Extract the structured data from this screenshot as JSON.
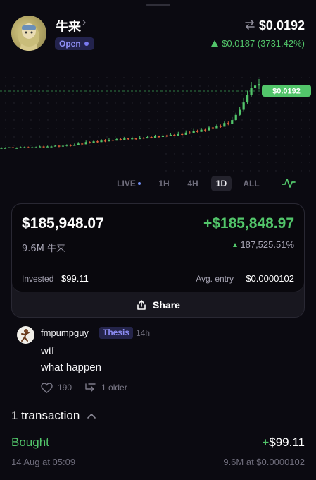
{
  "header": {
    "token_name": "牛来",
    "status": "Open",
    "price": "$0.0192",
    "change": "$0.0187 (3731.42%)",
    "icons": {
      "name": "chevron-right-icon",
      "swap": "swap-icon",
      "change": "triangle-up-icon"
    }
  },
  "chart": {
    "current_price_label": "$0.0192",
    "colors": {
      "up": "#52c56a",
      "down": "#e0603a",
      "dashed_line": "#2d6b3a",
      "grid_dot": "#2a2933"
    }
  },
  "chart_data": {
    "type": "candlestick",
    "x_unit": "candle index",
    "y_unit": "relative price",
    "candles": [
      [
        0.1,
        0.1,
        0.11,
        0.1
      ],
      [
        0.1,
        0.1,
        0.11,
        0.1
      ],
      [
        0.1,
        0.11,
        0.11,
        0.1
      ],
      [
        0.11,
        0.1,
        0.11,
        0.1
      ],
      [
        0.1,
        0.1,
        0.11,
        0.1
      ],
      [
        0.1,
        0.11,
        0.12,
        0.1
      ],
      [
        0.11,
        0.11,
        0.12,
        0.1
      ],
      [
        0.11,
        0.1,
        0.12,
        0.1
      ],
      [
        0.1,
        0.11,
        0.12,
        0.1
      ],
      [
        0.11,
        0.11,
        0.12,
        0.1
      ],
      [
        0.11,
        0.12,
        0.13,
        0.11
      ],
      [
        0.12,
        0.11,
        0.13,
        0.1
      ],
      [
        0.11,
        0.12,
        0.13,
        0.11
      ],
      [
        0.12,
        0.12,
        0.13,
        0.11
      ],
      [
        0.12,
        0.13,
        0.14,
        0.12
      ],
      [
        0.13,
        0.12,
        0.14,
        0.11
      ],
      [
        0.12,
        0.13,
        0.14,
        0.12
      ],
      [
        0.13,
        0.14,
        0.15,
        0.12
      ],
      [
        0.14,
        0.13,
        0.15,
        0.12
      ],
      [
        0.13,
        0.14,
        0.16,
        0.13
      ],
      [
        0.14,
        0.16,
        0.18,
        0.14
      ],
      [
        0.16,
        0.15,
        0.17,
        0.14
      ],
      [
        0.15,
        0.18,
        0.2,
        0.15
      ],
      [
        0.18,
        0.17,
        0.19,
        0.16
      ],
      [
        0.17,
        0.19,
        0.21,
        0.17
      ],
      [
        0.19,
        0.18,
        0.2,
        0.17
      ],
      [
        0.18,
        0.2,
        0.22,
        0.18
      ],
      [
        0.2,
        0.19,
        0.22,
        0.18
      ],
      [
        0.19,
        0.21,
        0.23,
        0.19
      ],
      [
        0.21,
        0.2,
        0.22,
        0.19
      ],
      [
        0.2,
        0.22,
        0.24,
        0.2
      ],
      [
        0.22,
        0.21,
        0.24,
        0.2
      ],
      [
        0.21,
        0.23,
        0.25,
        0.21
      ],
      [
        0.23,
        0.22,
        0.24,
        0.21
      ],
      [
        0.22,
        0.23,
        0.25,
        0.21
      ],
      [
        0.23,
        0.22,
        0.24,
        0.21
      ],
      [
        0.22,
        0.24,
        0.26,
        0.22
      ],
      [
        0.24,
        0.23,
        0.25,
        0.22
      ],
      [
        0.23,
        0.25,
        0.27,
        0.23
      ],
      [
        0.25,
        0.24,
        0.26,
        0.23
      ],
      [
        0.24,
        0.26,
        0.28,
        0.24
      ],
      [
        0.26,
        0.25,
        0.27,
        0.24
      ],
      [
        0.25,
        0.27,
        0.29,
        0.25
      ],
      [
        0.27,
        0.26,
        0.28,
        0.25
      ],
      [
        0.26,
        0.28,
        0.3,
        0.26
      ],
      [
        0.28,
        0.27,
        0.29,
        0.26
      ],
      [
        0.27,
        0.29,
        0.32,
        0.27
      ],
      [
        0.29,
        0.28,
        0.31,
        0.27
      ],
      [
        0.28,
        0.31,
        0.34,
        0.28
      ],
      [
        0.31,
        0.3,
        0.33,
        0.29
      ],
      [
        0.3,
        0.33,
        0.36,
        0.3
      ],
      [
        0.33,
        0.32,
        0.35,
        0.31
      ],
      [
        0.32,
        0.35,
        0.37,
        0.32
      ],
      [
        0.35,
        0.34,
        0.36,
        0.32
      ],
      [
        0.34,
        0.38,
        0.4,
        0.34
      ],
      [
        0.38,
        0.36,
        0.39,
        0.35
      ],
      [
        0.36,
        0.4,
        0.42,
        0.36
      ],
      [
        0.4,
        0.39,
        0.42,
        0.37
      ],
      [
        0.39,
        0.44,
        0.46,
        0.39
      ],
      [
        0.44,
        0.43,
        0.46,
        0.41
      ],
      [
        0.43,
        0.48,
        0.52,
        0.43
      ],
      [
        0.48,
        0.55,
        0.58,
        0.47
      ],
      [
        0.55,
        0.62,
        0.66,
        0.54
      ],
      [
        0.62,
        0.72,
        0.78,
        0.6
      ],
      [
        0.72,
        0.82,
        0.88,
        0.7
      ],
      [
        0.82,
        0.92,
        1.0,
        0.8
      ],
      [
        0.92,
        0.95,
        1.02,
        0.88
      ],
      [
        0.95,
        0.97,
        1.04,
        0.9
      ]
    ]
  },
  "timeframes": {
    "items": [
      "LIVE",
      "1H",
      "4H",
      "1D",
      "ALL"
    ],
    "active": "1D",
    "chart_icon": "pulse-icon"
  },
  "position": {
    "value": "$185,948.07",
    "pnl": "+$185,848.97",
    "amount": "9.6M 牛来",
    "pnl_pct": "187,525.51%",
    "invested_label": "Invested",
    "invested_value": "$99.11",
    "avg_entry_label": "Avg. entry",
    "avg_entry_value": "$0.0000102",
    "share_label": "Share"
  },
  "comment": {
    "username": "fmpumpguy",
    "badge": "Thesis",
    "time": "14h",
    "lines": [
      "wtf",
      "what happen"
    ],
    "likes": "190",
    "replies": "1 older"
  },
  "transactions": {
    "title": "1 transaction",
    "items": [
      {
        "type": "Bought",
        "amount_sign": "+",
        "amount": "$99.11",
        "date": "14 Aug at 05:09",
        "detail": "9.6M at $0.0000102"
      }
    ]
  }
}
